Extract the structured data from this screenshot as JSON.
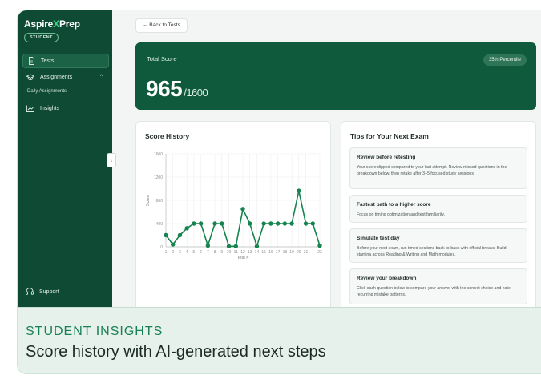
{
  "app": {
    "logo_prefix": "Aspire",
    "logo_x": "X",
    "logo_suffix": "Prep",
    "role": "STUDENT"
  },
  "sidebar": {
    "items": [
      {
        "label": "Tests",
        "icon": "document-icon",
        "active": true
      },
      {
        "label": "Assignments",
        "icon": "graduation-cap-icon",
        "expanded": true
      },
      {
        "label": "Daily Assignments",
        "sub": true
      },
      {
        "label": "Insights",
        "icon": "line-chart-icon"
      }
    ],
    "support_label": "Support",
    "collapse_glyph": "‹"
  },
  "main": {
    "back_label": "← Back to Tests",
    "total": {
      "label": "Total Score",
      "score": "965",
      "max": "/1600",
      "percentile": "35th Percentile"
    },
    "history_title": "Score History",
    "tips_title": "Tips for Your Next Exam",
    "tips": [
      {
        "title": "Review before retesting",
        "body": "Your score dipped compared to your last attempt. Review missed questions in the breakdown below, then retake after 3–5 focused study sessions."
      },
      {
        "title": "Fastest path to a higher score",
        "body": "Focus on timing optimization and test familiarity."
      },
      {
        "title": "Simulate test day",
        "body": "Before your next exam, run timed sections back-to-back with official breaks. Build stamina across Reading & Writing and Math modules."
      },
      {
        "title": "Review your breakdown",
        "body": "Click each question below to compare your answer with the correct choice and note recurring mistake patterns."
      }
    ]
  },
  "caption": {
    "kicker": "STUDENT INSIGHTS",
    "title": "Score history with AI-generated next steps"
  },
  "chart_data": {
    "type": "line",
    "title": "Score History",
    "xlabel": "Test #",
    "ylabel": "Score",
    "ylim": [
      0,
      1600
    ],
    "yticks": [
      0,
      400,
      800,
      1200,
      1600
    ],
    "xlim": [
      1,
      23
    ],
    "x_tick_labels": [
      "1",
      "2",
      "3",
      "4",
      "5",
      "6",
      "7",
      "8",
      "9",
      "10",
      "11",
      "12",
      "13",
      "14",
      "15",
      "16",
      "17",
      "18",
      "19",
      "20",
      "21",
      "23"
    ],
    "x": [
      1,
      2,
      3,
      4,
      5,
      6,
      7,
      8,
      9,
      10,
      11,
      12,
      13,
      14,
      15,
      16,
      17,
      18,
      19,
      20,
      21,
      22,
      23
    ],
    "values": [
      200,
      40,
      200,
      320,
      400,
      400,
      20,
      400,
      400,
      10,
      10,
      650,
      400,
      10,
      400,
      400,
      400,
      400,
      400,
      965,
      400,
      400,
      20
    ],
    "color": "#15844f",
    "grid": true
  }
}
